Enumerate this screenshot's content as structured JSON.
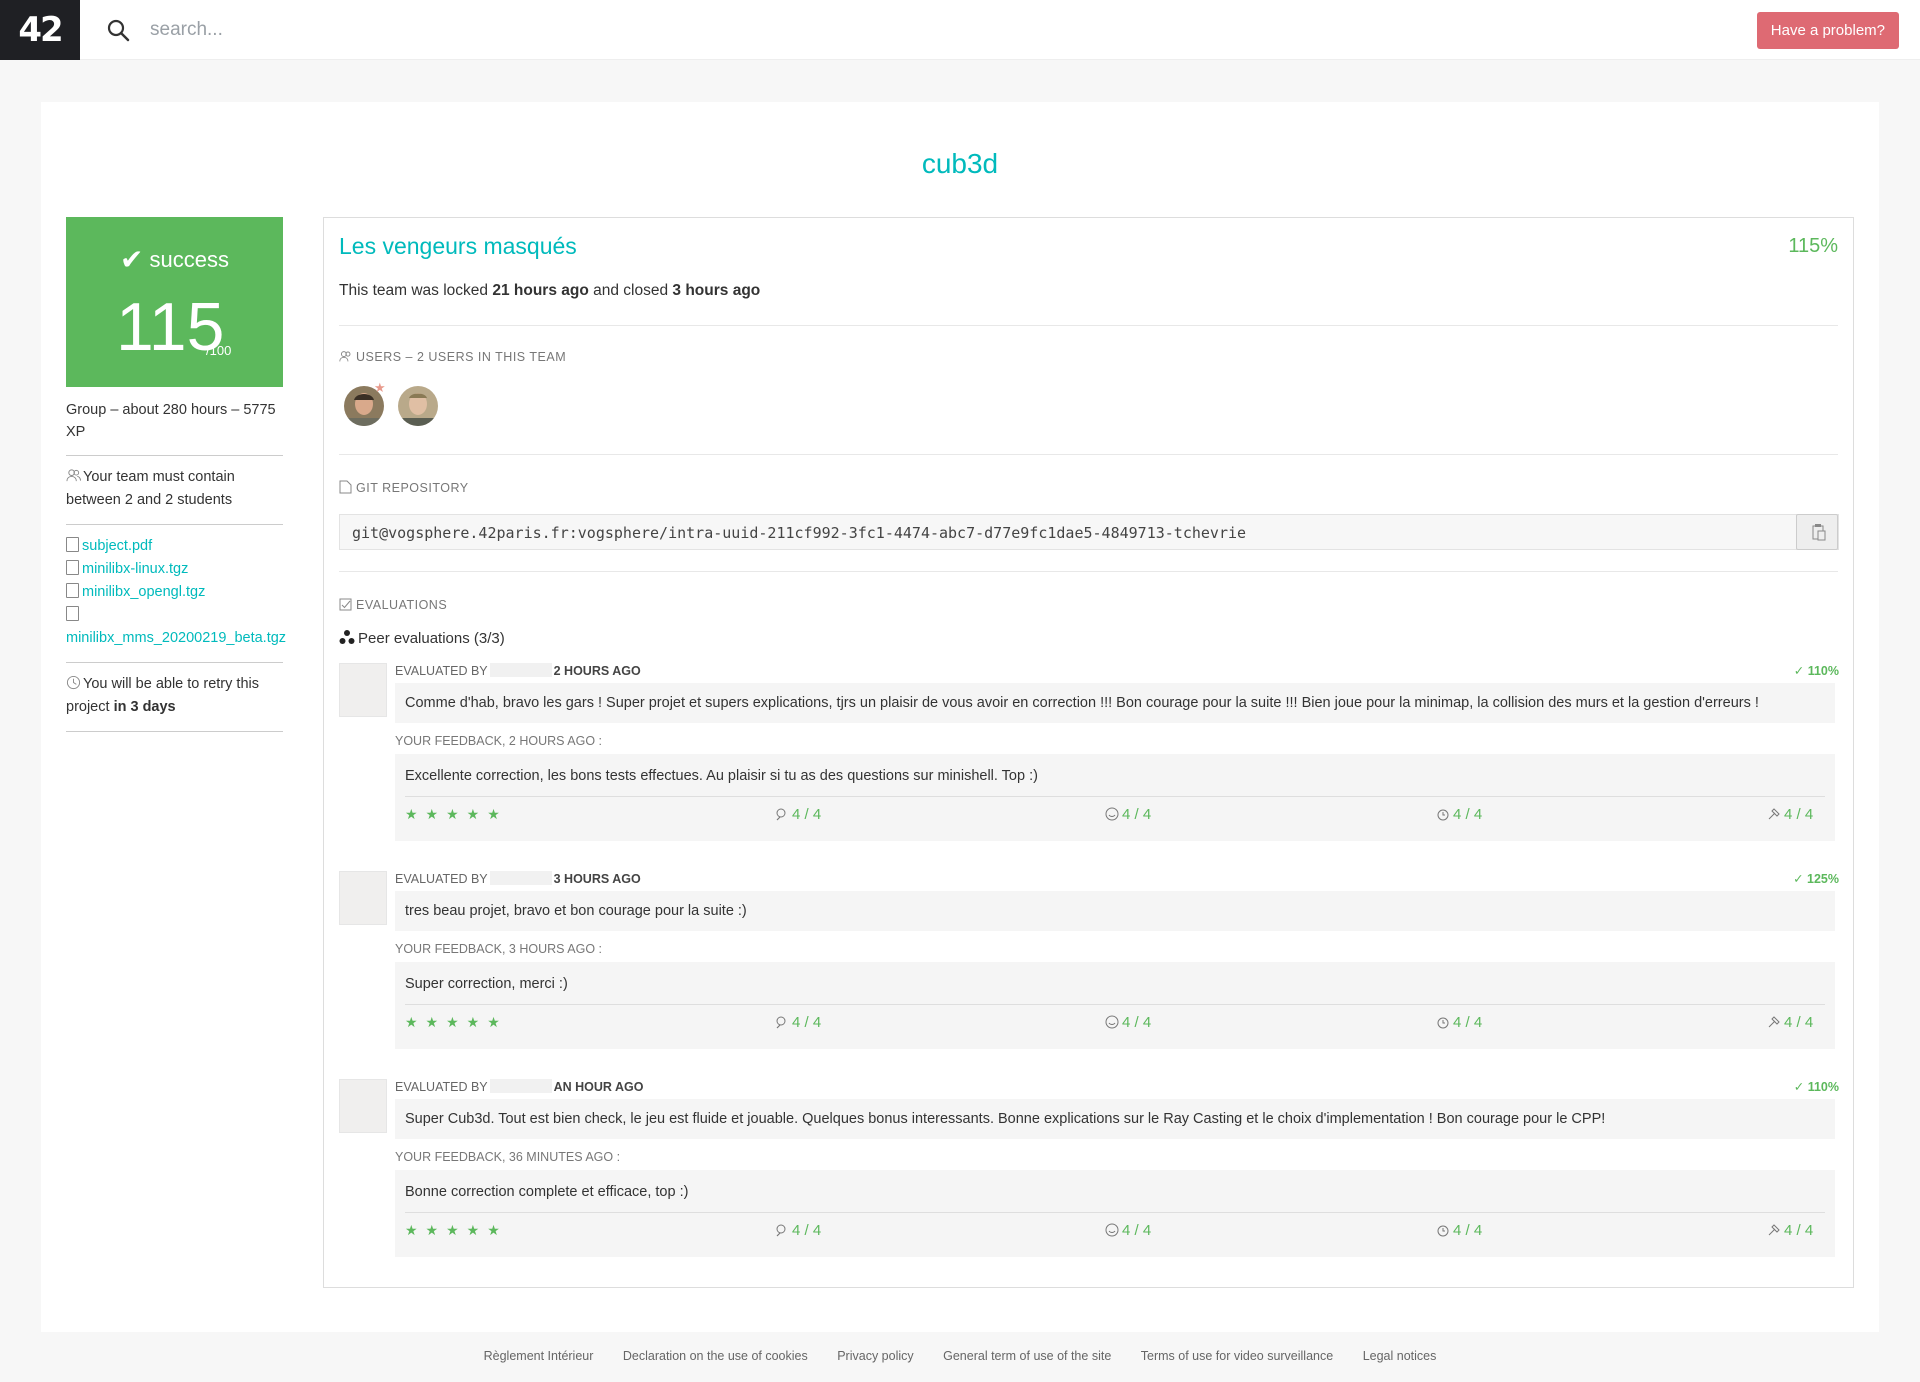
{
  "header": {
    "logo": "42",
    "search_placeholder": "search...",
    "problem_button": "Have a problem?"
  },
  "project": {
    "title": "cub3d",
    "status": "success",
    "mark": "115",
    "mark_max": "/100",
    "info": "Group – about 280 hours – 5775 XP",
    "team_rule": "Your team must contain between 2 and 2 students",
    "attachments": [
      "subject.pdf",
      "minilibx-linux.tgz",
      "minilibx_opengl.tgz",
      "minilibx_mms_20200219_beta.tgz"
    ],
    "retry_prefix": "You will be able to retry this project ",
    "retry_value": "in 3 days"
  },
  "team": {
    "name": "Les vengeurs masqués",
    "percent": "115%",
    "status_prefix": "This team was locked ",
    "locked": "21 hours ago",
    "status_mid": " and closed ",
    "closed": "3 hours ago",
    "users_label": "Users – 2 users in this team",
    "git_label": "Git repository",
    "repo": "git@vogsphere.42paris.fr:vogsphere/intra-uuid-211cf992-3fc1-4474-abc7-d77e9fc1dae5-4849713-tchevrie",
    "evaluations_label": "Evaluations",
    "peer_title": "Peer evaluations (3/3)"
  },
  "evaluations": [
    {
      "evaluated_by": "EVALUATED BY",
      "when": "2 HOURS AGO",
      "percent": "110%",
      "comment": "Comme d'hab, bravo les gars ! Super projet et supers explications, tjrs un plaisir de vous avoir en correction !!! Bon courage pour la suite !!! Bien joue pour la minimap, la collision des murs et la gestion d'erreurs !",
      "feedback_label": "YOUR FEEDBACK, 2 HOURS AGO :",
      "feedback": "Excellente correction, les bons tests effectues. Au plaisir si tu as des questions sur minishell. Top :)",
      "stars": "★★★★★",
      "scores": [
        "4 / 4",
        "4 / 4",
        "4 / 4",
        "4 / 4"
      ]
    },
    {
      "evaluated_by": "EVALUATED BY",
      "when": "3 HOURS AGO",
      "percent": "125%",
      "comment": "tres beau projet, bravo et bon courage pour la suite :)",
      "feedback_label": "YOUR FEEDBACK, 3 HOURS AGO :",
      "feedback": "Super correction, merci :)",
      "stars": "★★★★★",
      "scores": [
        "4 / 4",
        "4 / 4",
        "4 / 4",
        "4 / 4"
      ]
    },
    {
      "evaluated_by": "EVALUATED BY",
      "when": "AN HOUR AGO",
      "percent": "110%",
      "comment": "Super Cub3d. Tout est bien check, le jeu est fluide et jouable. Quelques bonus interessants. Bonne explications sur le Ray Casting et le choix d'implementation ! Bon courage pour le CPP!",
      "feedback_label": "YOUR FEEDBACK, 36 MINUTES AGO :",
      "feedback": "Bonne correction complete et efficace, top :)",
      "stars": "★★★★★",
      "scores": [
        "4 / 4",
        "4 / 4",
        "4 / 4",
        "4 / 4"
      ]
    }
  ],
  "footer": {
    "links": [
      "Règlement Intérieur",
      "Declaration on the use of cookies",
      "Privacy policy",
      "General term of use of the site",
      "Terms of use for video surveillance",
      "Legal notices"
    ]
  },
  "colors": {
    "accent": "#00babc",
    "success": "#5cb85c",
    "problem": "#de6a73",
    "logo_bg": "#1f2024"
  }
}
